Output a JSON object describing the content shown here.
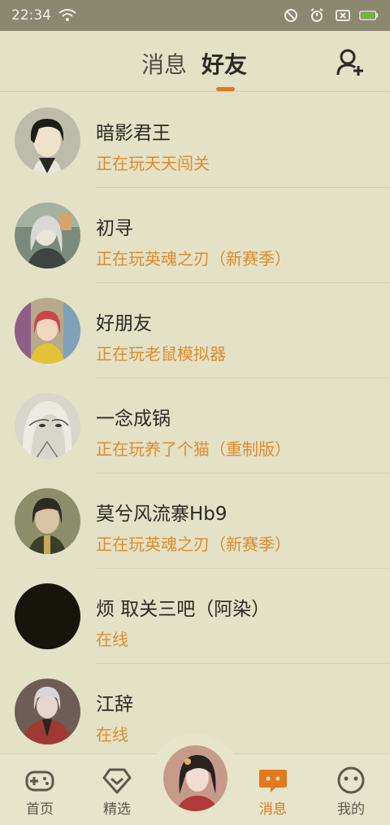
{
  "status_bar": {
    "time": "22:34"
  },
  "header": {
    "tabs": [
      {
        "label": "消息"
      },
      {
        "label": "好友"
      }
    ],
    "active_tab": "好友"
  },
  "friends": [
    {
      "name": "暗影君王",
      "status": "正在玩天天闯关"
    },
    {
      "name": "初寻",
      "status": "正在玩英魂之刃（新赛季）"
    },
    {
      "name": "好朋友",
      "status": "正在玩老鼠模拟器"
    },
    {
      "name": "一念成锅",
      "status": "正在玩养了个猫（重制版）"
    },
    {
      "name": "莫兮风流寨Hb9",
      "status": "正在玩英魂之刃（新赛季）"
    },
    {
      "name": "烦 取关三吧（阿染）",
      "status": "在线"
    },
    {
      "name": "江辞",
      "status": "在线"
    }
  ],
  "bottom_nav": {
    "items": [
      {
        "label": "首页"
      },
      {
        "label": "精选"
      },
      {
        "label": "消息"
      },
      {
        "label": "我的"
      }
    ],
    "active": "消息"
  },
  "colors": {
    "accent": "#E07A1E",
    "background": "#E3E1C6",
    "status_text": "#DE8C2C"
  }
}
